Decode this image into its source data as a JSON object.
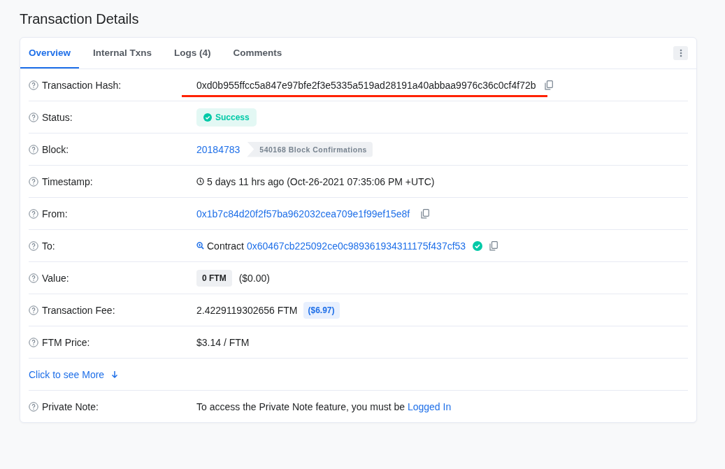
{
  "page_title": "Transaction Details",
  "tabs": [
    {
      "label": "Overview",
      "selected": true
    },
    {
      "label": "Internal Txns",
      "selected": false
    },
    {
      "label": "Logs (4)",
      "selected": false
    },
    {
      "label": "Comments",
      "selected": false
    }
  ],
  "rows": [
    {
      "kind": "hash",
      "label": "Transaction Hash:",
      "value": "0xd0b955ffcc5a847e97bfe2f3e5335a519ad28191a40abbaa9976c36c0cf4f72b",
      "underlined": true
    },
    {
      "kind": "status",
      "label": "Status:",
      "badge": "Success"
    },
    {
      "kind": "block",
      "label": "Block:",
      "link": "20184783",
      "confirmations": "540168 Block Confirmations"
    },
    {
      "kind": "timestamp",
      "label": "Timestamp:",
      "value": "5 days 11 hrs ago (Oct-26-2021 07:35:06 PM +UTC)"
    },
    {
      "kind": "address",
      "label": "From:",
      "link": "0x1b7c84d20f2f57ba962032cea709e1f99ef15e8f"
    },
    {
      "kind": "contract",
      "label": "To:",
      "prefix": "Contract",
      "link": "0x60467cb225092ce0c989361934311175f437cf53",
      "verified": true
    },
    {
      "kind": "value",
      "label": "Value:",
      "badge": "0 FTM",
      "value": "($0.00)"
    },
    {
      "kind": "fee",
      "label": "Transaction Fee:",
      "value": "2.4229119302656 FTM",
      "badge": "($6.97)"
    },
    {
      "kind": "text",
      "label": "FTM Price:",
      "value": "$3.14 / FTM"
    },
    {
      "kind": "more",
      "link": "Click to see More"
    },
    {
      "kind": "note",
      "label": "Private Note:",
      "value": "To access the Private Note feature, you must be",
      "link": "Logged In"
    }
  ]
}
